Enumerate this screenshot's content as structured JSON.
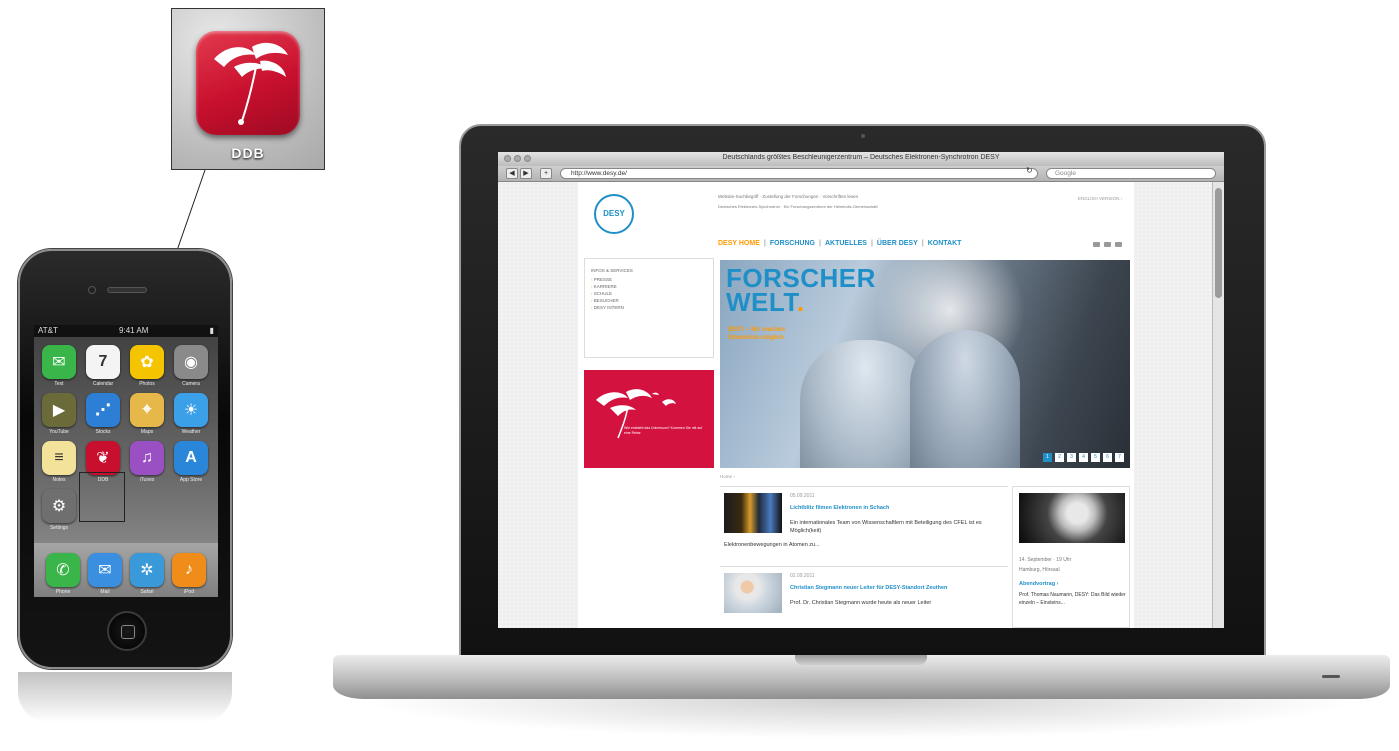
{
  "callout": {
    "app_label": "DDB"
  },
  "phone": {
    "status_left": "AT&T",
    "status_time": "9:41 AM",
    "apps": [
      {
        "icon": "messages-icon",
        "color": "#39b54a",
        "glyph": "✉",
        "label": "Text"
      },
      {
        "icon": "calendar-icon",
        "color": "#f4f4f4",
        "glyph": "7",
        "label": "Calendar"
      },
      {
        "icon": "photos-icon",
        "color": "#f5c400",
        "glyph": "✿",
        "label": "Photos"
      },
      {
        "icon": "camera-icon",
        "color": "#8a8a8a",
        "glyph": "◉",
        "label": "Camera"
      },
      {
        "icon": "youtube-icon",
        "color": "#6b6b3a",
        "glyph": "▶",
        "label": "YouTube"
      },
      {
        "icon": "stocks-icon",
        "color": "#2d7fd6",
        "glyph": "⋰",
        "label": "Stocks"
      },
      {
        "icon": "maps-icon",
        "color": "#e6b84a",
        "glyph": "⌖",
        "label": "Maps"
      },
      {
        "icon": "weather-icon",
        "color": "#3ba0e8",
        "glyph": "☀",
        "label": "Weather"
      },
      {
        "icon": "notes-icon",
        "color": "#f2e29a",
        "glyph": "≡",
        "label": "Notes"
      },
      {
        "icon": "ddb-icon",
        "color": "#c8102e",
        "glyph": "❦",
        "label": "DDB"
      },
      {
        "icon": "itunes-icon",
        "color": "#9a4fc2",
        "glyph": "♫",
        "label": "iTunes"
      },
      {
        "icon": "appstore-icon",
        "color": "#2a86d8",
        "glyph": "A",
        "label": "App Store"
      },
      {
        "icon": "settings-icon",
        "color": "#6f6f6f",
        "glyph": "⚙",
        "label": "Settings"
      }
    ],
    "dock": [
      {
        "icon": "phone-icon",
        "color": "#39b54a",
        "glyph": "✆",
        "label": "Phone"
      },
      {
        "icon": "mail-icon",
        "color": "#3b8fe0",
        "glyph": "✉",
        "label": "Mail"
      },
      {
        "icon": "safari-icon",
        "color": "#3a9ad9",
        "glyph": "✲",
        "label": "Safari"
      },
      {
        "icon": "ipod-icon",
        "color": "#f08c1a",
        "glyph": "♪",
        "label": "iPod"
      }
    ]
  },
  "browser": {
    "window_title": "Deutschlands größtes Beschleunigerzentrum – Deutsches Elektronen-Synchrotron DESY",
    "url": "http://www.desy.de/",
    "search_placeholder": "Google"
  },
  "site": {
    "logo_text": "DESY",
    "topline": "Website-Suchbegriff · Zustellung der Forschungen · Vorschriften lesen",
    "tagline": "Deutsches Elektronen-Synchrotron · Ein Forschungszentrum der Helmholtz-Gemeinschaft",
    "language": "ENGLISH VERSION ›",
    "nav": [
      {
        "label": "DESY HOME",
        "home": true
      },
      {
        "label": "FORSCHUNG",
        "home": false
      },
      {
        "label": "AKTUELLES",
        "home": false
      },
      {
        "label": "ÜBER DESY",
        "home": false
      },
      {
        "label": "KONTAKT",
        "home": false
      }
    ],
    "side_heading": "INFOS & SERVICES",
    "side_items": [
      "PRESSE",
      "KARRIERE",
      "SCHULE",
      "BESUCHER",
      "DESY INTERN"
    ],
    "promo_text": "Wie entsteht das Universum? Kommen Sie mit auf eine Reise",
    "hero_title_1": "FORSCHER",
    "hero_title_2": "WELT",
    "hero_dot": ".",
    "hero_sub": "DESY – Wir machen Erkenntnis möglich",
    "pager": [
      "1",
      "2",
      "3",
      "4",
      "5",
      "6",
      "7"
    ],
    "breadcrumb": "Home ›",
    "news": [
      {
        "date": "05.09.2011",
        "title": "Lichtblitz filmen Elektronen in Schach",
        "text": "Ein internationales Team von Wissenschaftlern mit Beteiligung des CFEL ist es Möglich(keit)",
        "text2": "Elektronenbewegungen in Atomen zu..."
      },
      {
        "date": "02.09.2011",
        "title": "Christian Stegmann neuer Leiter für DESY-Standort Zeuthen",
        "text": "Prof. Dr. Christian Stegmann wurde heute als neuer Leiter",
        "text2": ""
      }
    ],
    "event": {
      "date": "14. September · 19 Uhr",
      "location": "Hamburg, Hörsaal",
      "title": "Abendvortrag ›",
      "text": "Prof. Thomas Naumann, DESY: Das Bild wieder einzeln – Einsteins..."
    }
  }
}
